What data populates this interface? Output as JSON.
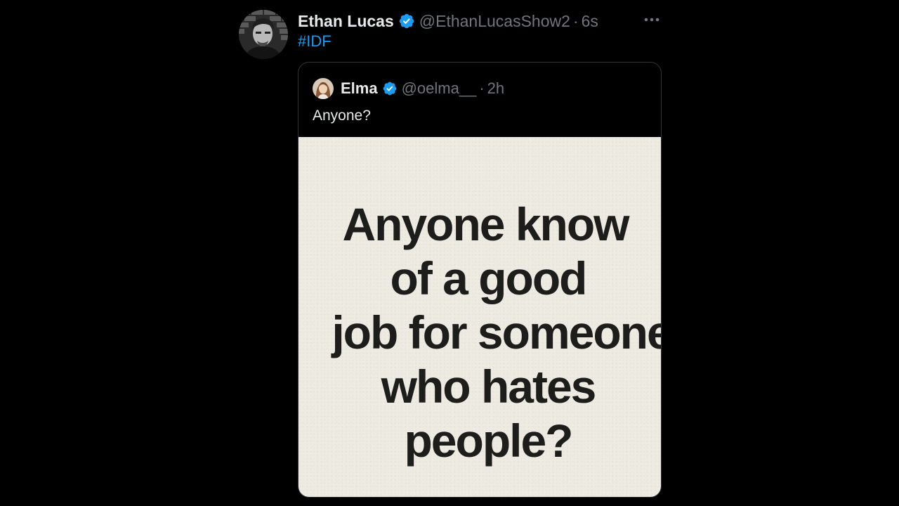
{
  "tweet": {
    "author": {
      "display_name": "Ethan Lucas",
      "handle": "@EthanLucasShow2",
      "separator": "·",
      "time": "6s",
      "verified": true
    },
    "text": "#IDF",
    "more_icon": "more-horizontal-icon",
    "verified_icon": "verified-badge-icon"
  },
  "quote": {
    "author": {
      "display_name": "Elma",
      "handle": "@oelma__",
      "separator": "·",
      "time": "2h",
      "verified": true
    },
    "text": "Anyone?",
    "media": {
      "lines": [
        "Anyone know",
        "of a good",
        "job for someone",
        "who hates",
        "people?"
      ],
      "background_color": "#eeebe3",
      "text_color": "#1d1d1b"
    }
  },
  "colors": {
    "background": "#000000",
    "primary_text": "#e7e9ea",
    "secondary_text": "#71767b",
    "accent": "#1d9bf0",
    "border": "#2f3336"
  }
}
